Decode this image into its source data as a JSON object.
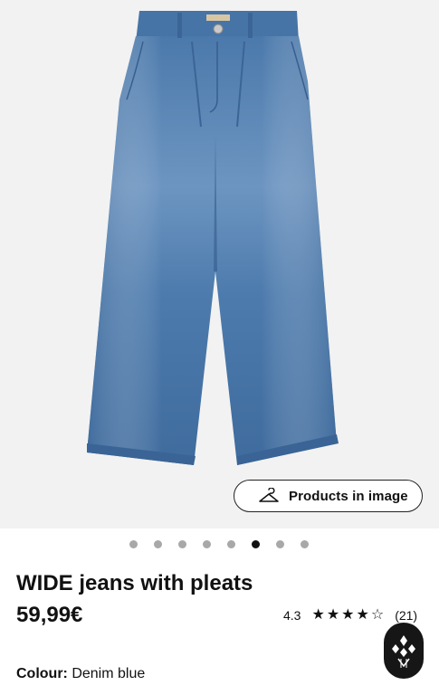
{
  "product_image": {
    "alt_icon": "wide-jeans-with-pleats-photo"
  },
  "products_button": {
    "label": "Products in image",
    "icon": "hanger-icon"
  },
  "carousel": {
    "total": 8,
    "active_index": 5
  },
  "product": {
    "title": "WIDE jeans with pleats",
    "price": "59,99€",
    "rating_score": "4.3",
    "rating_stars": 4.3,
    "rating_count": "(21)",
    "colour_label": "Colour:",
    "colour_value": "Denim blue"
  },
  "colors": {
    "denim": "#4a78aa",
    "background": "#f2f2f2",
    "active_dot": "#111111",
    "inactive_dot": "#a8a8a8"
  }
}
